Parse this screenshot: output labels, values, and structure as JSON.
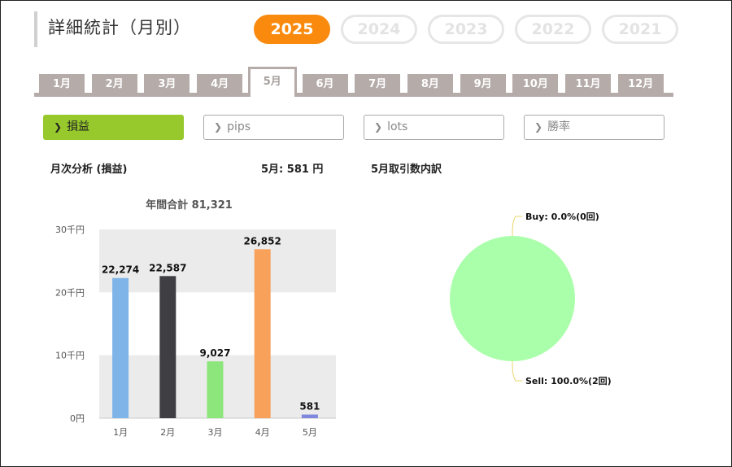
{
  "header": {
    "title": "詳細統計（月別）"
  },
  "years": [
    {
      "label": "2025",
      "active": true
    },
    {
      "label": "2024",
      "active": false
    },
    {
      "label": "2023",
      "active": false
    },
    {
      "label": "2022",
      "active": false
    },
    {
      "label": "2021",
      "active": false
    }
  ],
  "months": [
    "1月",
    "2月",
    "3月",
    "4月",
    "5月",
    "6月",
    "7月",
    "8月",
    "9月",
    "10月",
    "11月",
    "12月"
  ],
  "active_month_index": 4,
  "metrics": [
    {
      "label": "損益",
      "active": true
    },
    {
      "label": "pips",
      "active": false
    },
    {
      "label": "lots",
      "active": false
    },
    {
      "label": "勝率",
      "active": false
    }
  ],
  "summary": {
    "section_label": "月次分析 (損益)",
    "month_value": "5月:  581 円",
    "breakdown_label": "5月取引数内訳"
  },
  "colors": {
    "accent_orange": "#fa8a0e",
    "accent_green": "#97c92c",
    "tab_gray": "#b5acaa"
  },
  "chart_data": [
    {
      "type": "bar",
      "title": "年間合計 81,321",
      "categories": [
        "1月",
        "2月",
        "3月",
        "4月",
        "5月"
      ],
      "values": [
        22274,
        22587,
        9027,
        26852,
        581
      ],
      "value_labels": [
        "22,274",
        "22,587",
        "9,027",
        "26,852",
        "581"
      ],
      "colors": [
        "#7eb4e8",
        "#3f3f43",
        "#8ce67b",
        "#f7a15a",
        "#8088de"
      ],
      "ylim": [
        0,
        30000
      ],
      "yticks": [
        0,
        10000,
        20000,
        30000
      ],
      "ytick_labels": [
        "0円",
        "10千円",
        "20千円",
        "30千円"
      ],
      "grid": "alternating bands"
    },
    {
      "type": "pie",
      "slices": [
        {
          "label": "Buy: 0.0%(0回)",
          "value": 0,
          "color": "#aaffaa"
        },
        {
          "label": "Sell: 100.0%(2回)",
          "value": 100,
          "color": "#aaffaa"
        }
      ],
      "leader_color": "#e8d56a"
    }
  ]
}
